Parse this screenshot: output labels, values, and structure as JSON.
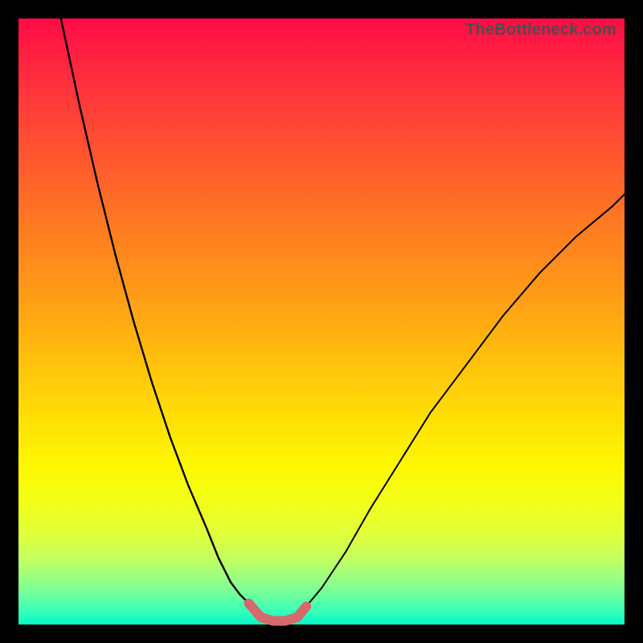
{
  "watermark": {
    "text": "TheBottleneck.com"
  },
  "colors": {
    "page_bg": "#000000",
    "curve_stroke": "#000000",
    "valley_stroke": "#d46a6a",
    "watermark_text": "#4d4d4d"
  },
  "chart_data": {
    "type": "line",
    "title": "",
    "xlabel": "",
    "ylabel": "",
    "xlim": [
      0,
      100
    ],
    "ylim": [
      0,
      100
    ],
    "annotations": [
      "TheBottleneck.com"
    ],
    "series": [
      {
        "name": "left-branch",
        "x": [
          7,
          10,
          13,
          16,
          19,
          22,
          25,
          28,
          31,
          33,
          35,
          36.5,
          38
        ],
        "y": [
          100,
          86,
          73,
          61,
          50,
          40,
          31,
          23,
          16,
          11,
          7,
          5,
          3.5
        ]
      },
      {
        "name": "valley-floor",
        "x": [
          38,
          40,
          42,
          44,
          46,
          47.5
        ],
        "y": [
          3.5,
          1.2,
          0.6,
          0.6,
          1.2,
          3.0
        ]
      },
      {
        "name": "right-branch",
        "x": [
          47.5,
          50,
          54,
          58,
          63,
          68,
          74,
          80,
          86,
          92,
          98,
          100
        ],
        "y": [
          3.0,
          6,
          12,
          19,
          27,
          35,
          43,
          51,
          58,
          64,
          69,
          71
        ]
      }
    ],
    "grid": false,
    "legend": false
  }
}
